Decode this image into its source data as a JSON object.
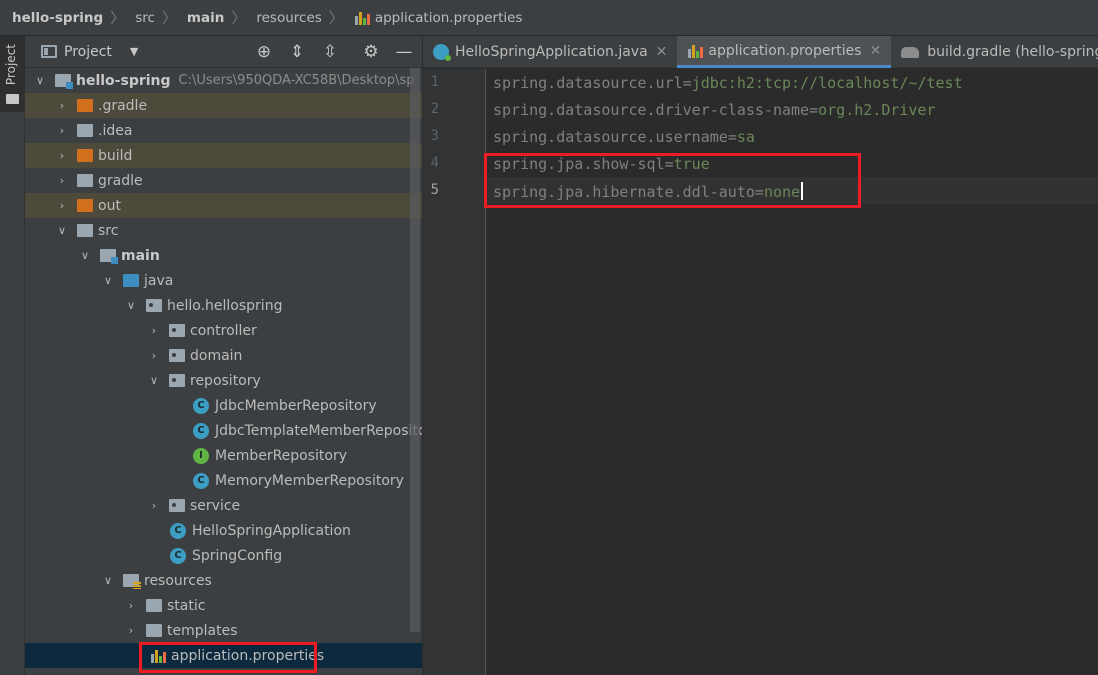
{
  "breadcrumb": [
    "hello-spring",
    "src",
    "main",
    "resources",
    "application.properties"
  ],
  "stripe": {
    "label": "Project"
  },
  "project": {
    "title": "Project",
    "rows": [
      {
        "label": "hello-spring",
        "path": "C:\\Users\\950QDA-XC58B\\Desktop\\sp"
      },
      {
        "label": ".gradle"
      },
      {
        "label": ".idea"
      },
      {
        "label": "build"
      },
      {
        "label": "gradle"
      },
      {
        "label": "out"
      },
      {
        "label": "src"
      },
      {
        "label": "main"
      },
      {
        "label": "java"
      },
      {
        "label": "hello.hellospring"
      },
      {
        "label": "controller"
      },
      {
        "label": "domain"
      },
      {
        "label": "repository"
      },
      {
        "label": "JdbcMemberRepository",
        "icon": "C"
      },
      {
        "label": "JdbcTemplateMemberRepository",
        "icon": "C"
      },
      {
        "label": "MemberRepository",
        "icon": "I"
      },
      {
        "label": "MemoryMemberRepository",
        "icon": "C"
      },
      {
        "label": "service"
      },
      {
        "label": "HelloSpringApplication",
        "icon": "C"
      },
      {
        "label": "SpringConfig",
        "icon": "C"
      },
      {
        "label": "resources"
      },
      {
        "label": "static"
      },
      {
        "label": "templates"
      },
      {
        "label": "application.properties"
      }
    ]
  },
  "tabs": [
    {
      "label": "HelloSpringApplication.java"
    },
    {
      "label": "application.properties",
      "active": true
    },
    {
      "label": "build.gradle (hello-spring)"
    }
  ],
  "editor": {
    "line_numbers": [
      "1",
      "2",
      "3",
      "4",
      "5"
    ],
    "lines": [
      {
        "key": "spring.datasource.url",
        "value": "jdbc:h2:tcp://localhost/~/test"
      },
      {
        "key": "spring.datasource.driver-class-name",
        "value": "org.h2.Driver"
      },
      {
        "key": "spring.datasource.username",
        "value": "sa"
      },
      {
        "key": "spring.jpa.show-sql",
        "value": "true"
      },
      {
        "key": "spring.jpa.hibernate.ddl-auto",
        "value": "none"
      }
    ]
  },
  "colors": {
    "highlight_box": "#ed1c24",
    "property_value": "#6a8759",
    "property_key": "#808080"
  }
}
